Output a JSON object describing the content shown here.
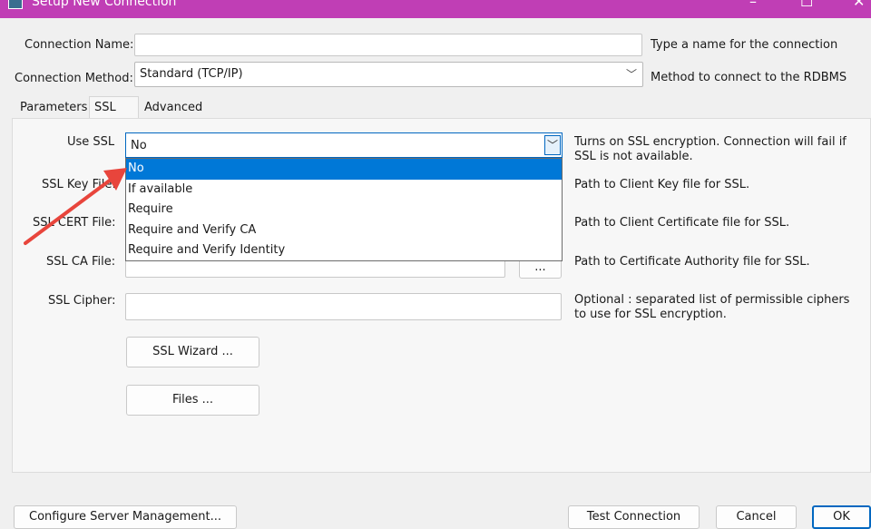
{
  "window": {
    "title": "Setup New Connection"
  },
  "fields": {
    "connection_name_label": "Connection Name:",
    "connection_name_value": "",
    "connection_name_hint": "Type a name for the connection",
    "connection_method_label": "Connection Method:",
    "connection_method_value": "Standard (TCP/IP)",
    "connection_method_hint": "Method to connect to the RDBMS"
  },
  "tabs": [
    {
      "label": "Parameters"
    },
    {
      "label": "SSL"
    },
    {
      "label": "Advanced"
    }
  ],
  "ssl": {
    "use_ssl_label": "Use SSL",
    "use_ssl_value": "No",
    "use_ssl_hint": "Turns on SSL encryption. Connection will fail if SSL is not available.",
    "options": [
      "No",
      "If available",
      "Require",
      "Require and Verify CA",
      "Require and Verify Identity"
    ],
    "key_file_label": "SSL Key File:",
    "key_file_hint": "Path to Client Key file for SSL.",
    "cert_file_label": "SSL CERT File:",
    "cert_file_hint": "Path to Client Certificate file for SSL.",
    "ca_file_label": "SSL CA File:",
    "ca_file_hint": "Path to Certificate Authority file for SSL.",
    "browse_label": "...",
    "cipher_label": "SSL Cipher:",
    "cipher_hint": "Optional : separated list of permissible ciphers to use for SSL encryption.",
    "wizard_button": "SSL Wizard ...",
    "files_button": "Files ..."
  },
  "footer": {
    "configure_button": "Configure Server Management...",
    "test_button": "Test Connection",
    "cancel_button": "Cancel",
    "ok_button": "OK"
  },
  "colors": {
    "title_bar": "#c03eb5",
    "accent": "#0078d7",
    "annotation_arrow": "#e8453c"
  }
}
